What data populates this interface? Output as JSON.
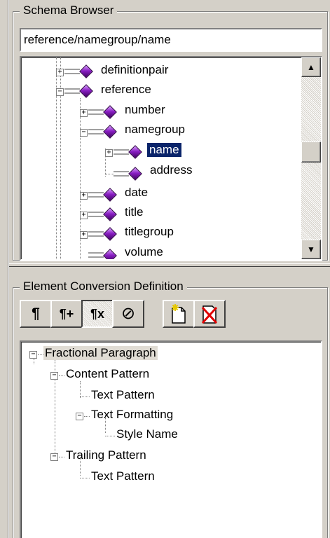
{
  "schema_browser": {
    "title": "Schema Browser",
    "path_value": "reference/namegroup/name",
    "tree": [
      {
        "label": "definitionpair"
      },
      {
        "label": "reference"
      },
      {
        "label": "number"
      },
      {
        "label": "namegroup"
      },
      {
        "label": "name"
      },
      {
        "label": "address"
      },
      {
        "label": "date"
      },
      {
        "label": "title"
      },
      {
        "label": "titlegroup"
      },
      {
        "label": "volume"
      }
    ],
    "scroll_up_glyph": "▲",
    "scroll_down_glyph": "▼"
  },
  "conversion": {
    "title": "Element Conversion Definition",
    "toolbar": {
      "paragraph": "¶",
      "paragraph_plus": "¶+",
      "fractional": "¶x",
      "none": "⊘"
    },
    "tree": [
      {
        "label": "Fractional Paragraph"
      },
      {
        "label": "Content Pattern"
      },
      {
        "label": "Text Pattern"
      },
      {
        "label": "Text Formatting"
      },
      {
        "label": "Style Name"
      },
      {
        "label": "Trailing Pattern"
      },
      {
        "label": "Text Pattern"
      }
    ]
  },
  "colors": {
    "face": "#d4d0c8",
    "selection": "#0a246a",
    "gem": "#8a1fc4"
  }
}
